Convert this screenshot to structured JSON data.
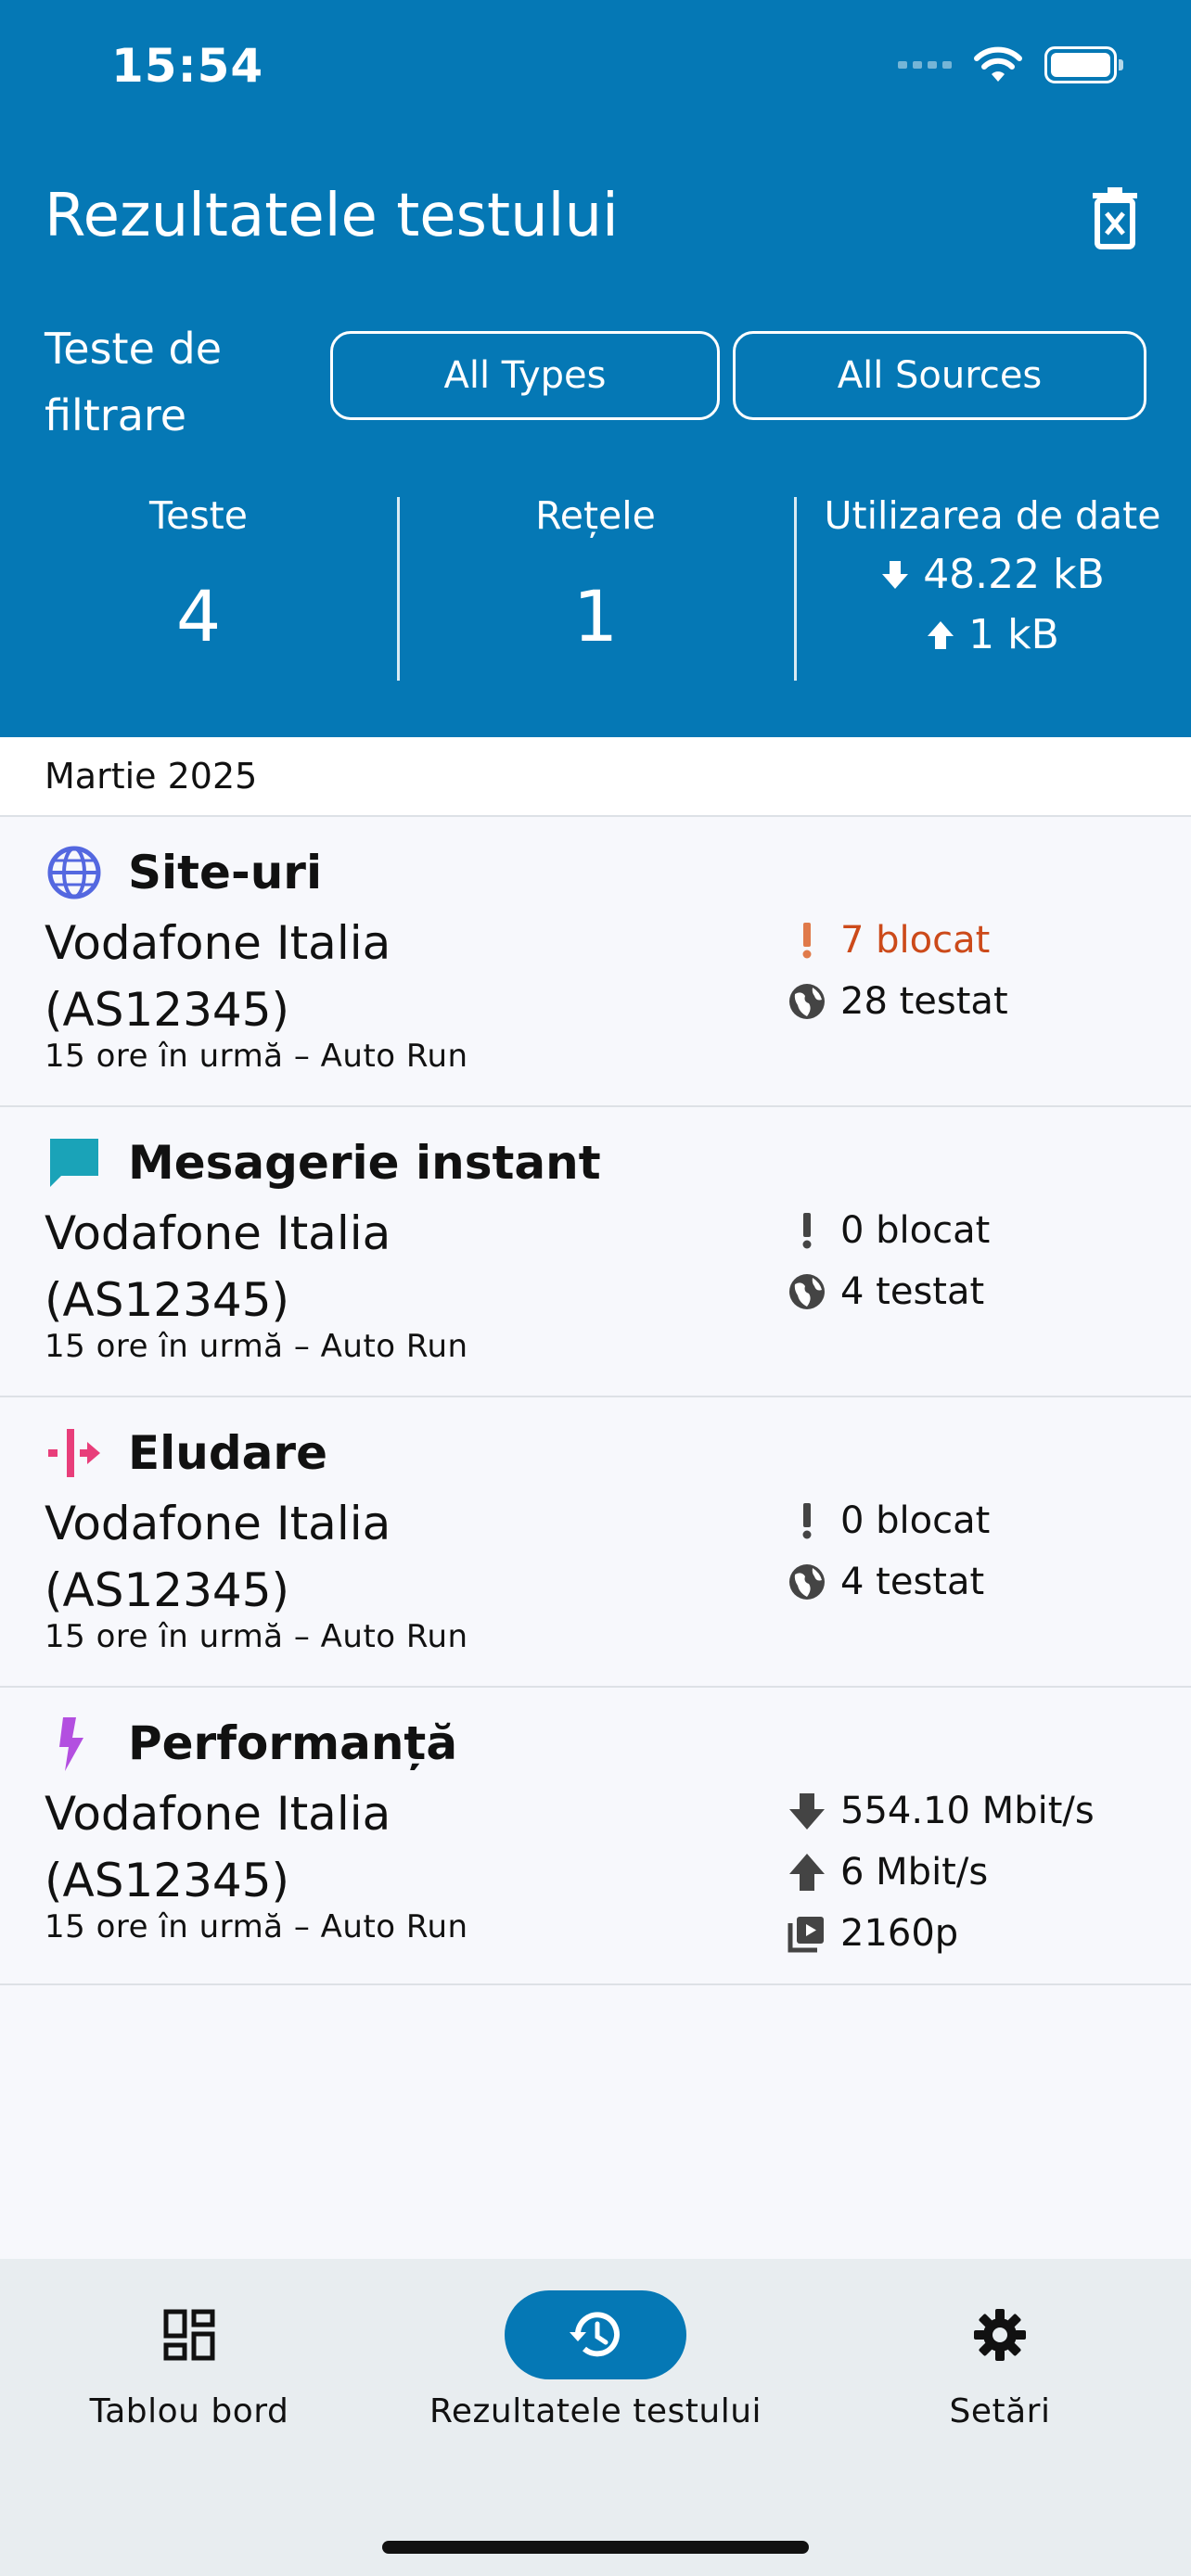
{
  "status_bar": {
    "time": "15:54"
  },
  "header": {
    "title": "Rezultatele testului",
    "filter_label": "Teste de filtrare",
    "filter_types": "All Types",
    "filter_sources": "All Sources"
  },
  "stats": {
    "tests_label": "Teste",
    "tests_value": "4",
    "networks_label": "Rețele",
    "networks_value": "1",
    "data_label": "Utilizarea de date",
    "download": "48.22 kB",
    "upload": "1 kB"
  },
  "month": "Martie 2025",
  "results": [
    {
      "icon": "globe-icon",
      "title": "Site-uri",
      "network": "Vodafone Italia (AS12345)",
      "meta": "15 ore în urmă – Auto Run",
      "blocked": "7 blocat",
      "tested": "28 testat",
      "accent": "#5468e0",
      "alert_color": "#cc4a1a"
    },
    {
      "icon": "chat-icon",
      "title": "Mesagerie instant",
      "network": "Vodafone Italia (AS12345)",
      "meta": "15 ore în urmă – Auto Run",
      "blocked": "0 blocat",
      "tested": "4 testat",
      "accent": "#1aa3b8"
    },
    {
      "icon": "circumvention-icon",
      "title": "Eludare",
      "network": "Vodafone Italia (AS12345)",
      "meta": "15 ore în urmă – Auto Run",
      "blocked": "0 blocat",
      "tested": "4 testat",
      "accent": "#e83e7a"
    },
    {
      "icon": "lightning-icon",
      "title": "Performanță",
      "network": "Vodafone Italia (AS12345)",
      "meta": "15 ore în urmă – Auto Run",
      "download": "554.10 Mbit/s",
      "upload": "6 Mbit/s",
      "video": "2160p",
      "accent": "#b34fe0"
    }
  ],
  "nav": {
    "dashboard": "Tablou bord",
    "results": "Rezultatele testului",
    "settings": "Setări",
    "active_color": "#0578b5"
  }
}
